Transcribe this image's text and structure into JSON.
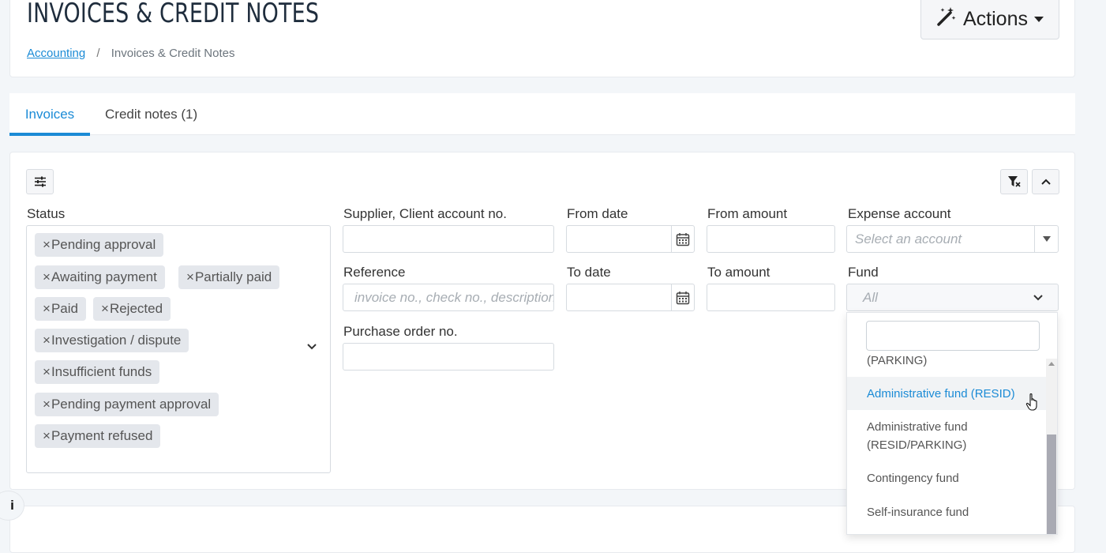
{
  "header": {
    "title": "INVOICES & CREDIT NOTES",
    "breadcrumb_link": "Accounting",
    "breadcrumb_sep": "/",
    "breadcrumb_current": "Invoices & Credit Notes",
    "actions_label": "Actions"
  },
  "tabs": [
    {
      "label": "Invoices",
      "active": true
    },
    {
      "label": "Credit notes (1)",
      "active": false
    }
  ],
  "filters": {
    "status_label": "Status",
    "status_chips": [
      "Pending approval",
      "Awaiting payment",
      "Partially paid",
      "Paid",
      "Rejected",
      "Investigation / dispute",
      "Insufficient funds",
      "Pending payment approval",
      "Payment refused"
    ],
    "chip_remove": "×",
    "supplier_label": "Supplier, Client account no.",
    "supplier_value": "",
    "reference_label": "Reference",
    "reference_placeholder": "invoice no., check no., description",
    "po_label": "Purchase order no.",
    "po_value": "",
    "from_date_label": "From date",
    "to_date_label": "To date",
    "from_amount_label": "From amount",
    "to_amount_label": "To amount",
    "expense_label": "Expense account",
    "expense_placeholder": "Select an account",
    "fund_label": "Fund",
    "fund_value": "All"
  },
  "fund_dropdown": {
    "search_value": "",
    "items": [
      {
        "label": "(PARKING)",
        "highlighted": false
      },
      {
        "label": "Administrative fund (RESID)",
        "highlighted": true
      },
      {
        "label": "Administrative fund (RESID/PARKING)",
        "highlighted": false
      },
      {
        "label": "Contingency fund",
        "highlighted": false
      },
      {
        "label": "Self-insurance fund",
        "highlighted": false
      }
    ]
  },
  "info_label": "i",
  "colors": {
    "accent": "#1b8bd6",
    "chip_bg": "#e4e7ec",
    "page_bg": "#f3f6f9"
  }
}
